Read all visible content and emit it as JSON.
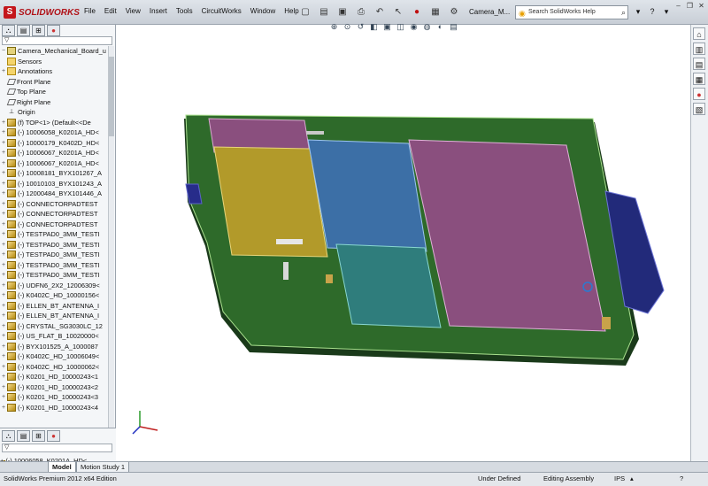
{
  "app": {
    "logo_text": "SOLIDWORKS",
    "logo_mark": "S"
  },
  "menu": [
    "File",
    "Edit",
    "View",
    "Insert",
    "Tools",
    "CircuitWorks",
    "Window",
    "Help"
  ],
  "toolbar": {
    "doc_title": "Camera_M...",
    "search_placeholder": "Search SolidWorks Help"
  },
  "feature_tree": {
    "filter_icon": "funnel-icon",
    "root": "Camera_Mechanical_Board_u",
    "items": [
      {
        "label": "Sensors",
        "icon": "folder"
      },
      {
        "label": "Annotations",
        "icon": "folder",
        "expand": "+"
      },
      {
        "label": "Front Plane",
        "icon": "plane"
      },
      {
        "label": "Top Plane",
        "icon": "plane"
      },
      {
        "label": "Right Plane",
        "icon": "plane"
      },
      {
        "label": "Origin",
        "icon": "origin"
      },
      {
        "label": "(f) TOP<1> (Default<<De",
        "icon": "part",
        "expand": "+"
      },
      {
        "label": "(-) 10006058_K0201A_HD<",
        "icon": "part",
        "expand": "+"
      },
      {
        "label": "(-) 10000179_K0402D_HD<",
        "icon": "part",
        "expand": "+"
      },
      {
        "label": "(-) 10006067_K0201A_HD<",
        "icon": "part",
        "expand": "+"
      },
      {
        "label": "(-) 10006067_K0201A_HD<",
        "icon": "part",
        "expand": "+"
      },
      {
        "label": "(-) 10008181_BYX101267_A",
        "icon": "part",
        "expand": "+"
      },
      {
        "label": "(-) 10010103_BYX101243_A",
        "icon": "part",
        "expand": "+"
      },
      {
        "label": "(-) 12000484_BYX101446_A",
        "icon": "part",
        "expand": "+"
      },
      {
        "label": "(-) CONNECTORPADTEST",
        "icon": "part",
        "expand": "+"
      },
      {
        "label": "(-) CONNECTORPADTEST",
        "icon": "part",
        "expand": "+"
      },
      {
        "label": "(-) CONNECTORPADTEST",
        "icon": "part",
        "expand": "+"
      },
      {
        "label": "(-) TESTPAD0_3MM_TESTI",
        "icon": "part",
        "expand": "+"
      },
      {
        "label": "(-) TESTPAD0_3MM_TESTI",
        "icon": "part",
        "expand": "+"
      },
      {
        "label": "(-) TESTPAD0_3MM_TESTI",
        "icon": "part",
        "expand": "+"
      },
      {
        "label": "(-) TESTPAD0_3MM_TESTI",
        "icon": "part",
        "expand": "+"
      },
      {
        "label": "(-) TESTPAD0_3MM_TESTI",
        "icon": "part",
        "expand": "+"
      },
      {
        "label": "(-) UDFN6_2X2_12006309<",
        "icon": "part",
        "expand": "+"
      },
      {
        "label": "(-) K0402C_HD_10000156<",
        "icon": "part",
        "expand": "+"
      },
      {
        "label": "(-) ELLEN_BT_ANTENNA_I",
        "icon": "part",
        "expand": "+"
      },
      {
        "label": "(-) ELLEN_BT_ANTENNA_I",
        "icon": "part",
        "expand": "+"
      },
      {
        "label": "(-) CRYSTAL_SG3030LC_12",
        "icon": "part",
        "expand": "+"
      },
      {
        "label": "(-) US_FLAT_B_10020000<",
        "icon": "part",
        "expand": "+"
      },
      {
        "label": "(-) BYX101525_A_1000087",
        "icon": "part",
        "expand": "+"
      },
      {
        "label": "(-) K0402C_HD_10006049<",
        "icon": "part",
        "expand": "+"
      },
      {
        "label": "(-) K0402C_HD_10000062<",
        "icon": "part",
        "expand": "+"
      },
      {
        "label": "(-) K0201_HD_10000243<1",
        "icon": "part",
        "expand": "+"
      },
      {
        "label": "(-) K0201_HD_10000243<2",
        "icon": "part",
        "expand": "+"
      },
      {
        "label": "(-) K0201_HD_10000243<3",
        "icon": "part",
        "expand": "+"
      },
      {
        "label": "(-) K0201_HD_10000243<4",
        "icon": "part",
        "expand": "+"
      }
    ]
  },
  "lower_panel": {
    "row": "(-) 10006058_K0201A_HD<"
  },
  "bottom_tabs": [
    "Model",
    "Motion Study 1"
  ],
  "status": {
    "edition": "SolidWorks Premium 2012 x64 Edition",
    "state": "Under Defined",
    "mode": "Editing Assembly",
    "units": "IPS",
    "help": "?"
  },
  "colors": {
    "board": "#2e6a2a",
    "board_edge": "#a9e08e",
    "comp_pink": "#8a4f7e",
    "comp_yellow": "#b29a2a",
    "comp_blue": "#3c6fa6",
    "comp_teal": "#2f7d7c",
    "connector": "#222a7a"
  }
}
